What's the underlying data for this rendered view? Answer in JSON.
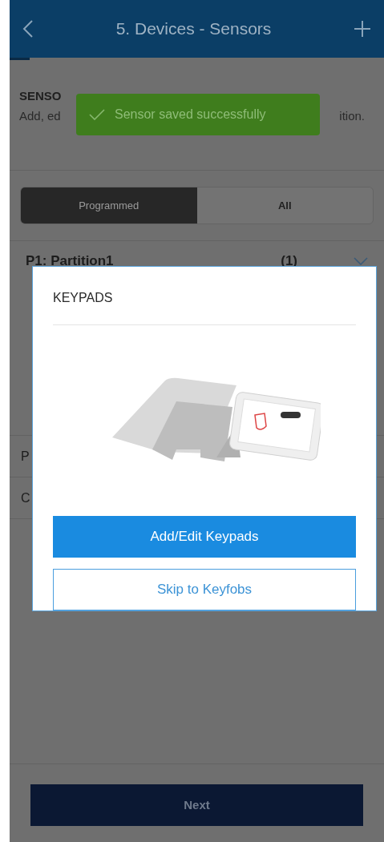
{
  "header": {
    "title": "5. Devices - Sensors"
  },
  "section": {
    "heading": "SENSO",
    "description_left": "Add, ed",
    "description_right": "ition."
  },
  "toast": {
    "message": "Sensor saved successfully"
  },
  "filter_tabs": [
    {
      "label": "Programmed",
      "selected": true
    },
    {
      "label": "All",
      "selected": false
    }
  ],
  "partitions": [
    {
      "name": "P1: Partition1",
      "count": "(1)",
      "expanded": false
    },
    {
      "name": "P"
    },
    {
      "name": "C"
    }
  ],
  "dialog": {
    "title": "KEYPADS",
    "primary_button": "Add/Edit Keypads",
    "secondary_button": "Skip to Keyfobs"
  },
  "footer": {
    "button": "Next"
  }
}
